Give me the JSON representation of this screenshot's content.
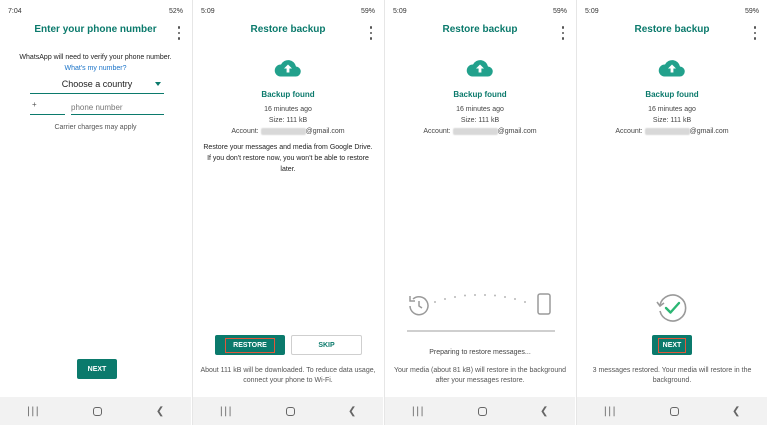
{
  "colors": {
    "accent": "#0b7a6c",
    "link": "#1a73c8",
    "highlight": "#e0563b"
  },
  "screens": [
    {
      "status": {
        "time": "7:04",
        "right": "52%"
      },
      "title": "Enter your phone number",
      "description": "WhatsApp will need to verify your phone number.",
      "link": "What's my number?",
      "country": "Choose a country",
      "code_prefix": "+",
      "phone_placeholder": "phone number",
      "carrier": "Carrier charges may apply",
      "next": "NEXT"
    },
    {
      "status": {
        "time": "5:09",
        "right": "59%"
      },
      "title": "Restore backup",
      "found": "Backup found",
      "ago": "16 minutes ago",
      "size": "Size: 111 kB",
      "account_label": "Account:",
      "account_domain": "@gmail.com",
      "text": "Restore your messages and media from Google Drive. If you don't restore now, you won't be able to restore later.",
      "restore": "RESTORE",
      "skip": "SKIP",
      "footer": "About 111 kB will be downloaded. To reduce data usage, connect your phone to Wi-Fi."
    },
    {
      "status": {
        "time": "5:09",
        "right": "59%"
      },
      "title": "Restore backup",
      "found": "Backup found",
      "ago": "16 minutes ago",
      "size": "Size: 111 kB",
      "account_label": "Account:",
      "account_domain": "@gmail.com",
      "preparing": "Preparing to restore messages...",
      "footer": "Your media (about 81 kB) will restore in the background after your messages restore."
    },
    {
      "status": {
        "time": "5:09",
        "right": "59%"
      },
      "title": "Restore backup",
      "found": "Backup found",
      "ago": "16 minutes ago",
      "size": "Size: 111 kB",
      "account_label": "Account:",
      "account_domain": "@gmail.com",
      "next": "NEXT",
      "footer": "3 messages restored. Your media will restore in the background."
    }
  ],
  "icons": {
    "cloud": "cloud-upload-icon",
    "restore_progress": "history-to-phone-icon",
    "done": "history-check-icon",
    "menu": "more-vert-icon"
  }
}
